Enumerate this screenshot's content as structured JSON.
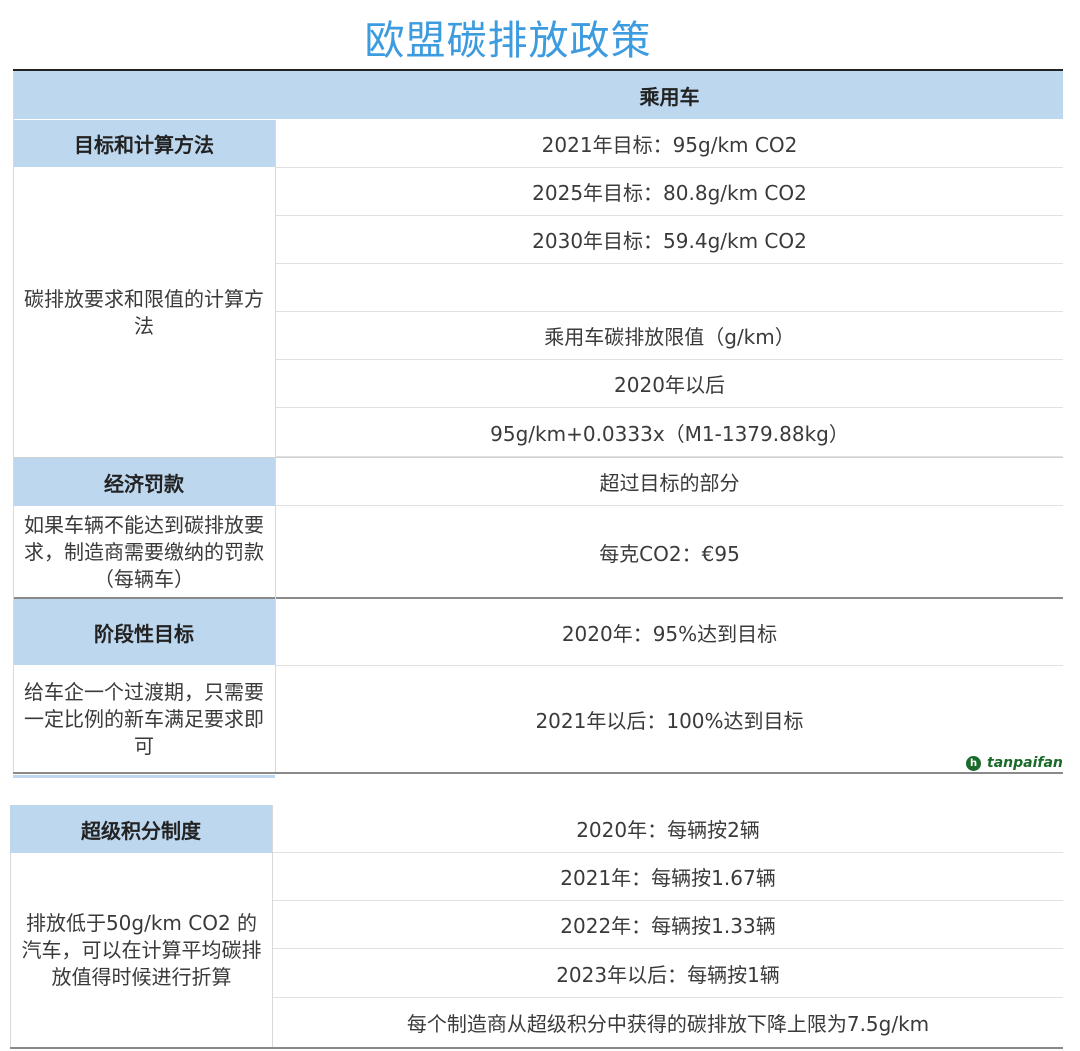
{
  "title": "欧盟碳排放政策",
  "header": {
    "column": "乘用车"
  },
  "sections": {
    "targets": {
      "label": "目标和计算方法",
      "description": "碳排放要求和限值的计算方法",
      "values": [
        "2021年目标：95g/km CO2",
        "2025年目标：80.8g/km CO2",
        "2030年目标：59.4g/km CO2",
        "",
        "乘用车碳排放限值（g/km）",
        "2020年以后",
        "95g/km+0.0333x（M1-1379.88kg）"
      ]
    },
    "penalty": {
      "label": "经济罚款",
      "description": "如果车辆不能达到碳排放要求，制造商需要缴纳的罚款（每辆车）",
      "values": [
        "超过目标的部分",
        "每克CO2：€95"
      ]
    },
    "phase": {
      "label": "阶段性目标",
      "description": "给车企一个过渡期，只需要一定比例的新车满足要求即可",
      "values": [
        "2020年：95%达到目标",
        "2021年以后：100%达到目标"
      ]
    },
    "supercredit": {
      "label": "超级积分制度",
      "description": "排放低于50g/km CO2 的汽车，可以在计算平均碳排放值得时候进行折算",
      "values": [
        "2020年：每辆按2辆",
        "2021年：每辆按1.67辆",
        "2022年：每辆按1.33辆",
        "2023年以后：每辆按1辆",
        "每个制造商从超级积分中获得的碳排放下降上限为7.5g/km"
      ]
    }
  },
  "watermark": {
    "text": "tanpaifan",
    "icon": "tanpaifang-logo-icon"
  }
}
